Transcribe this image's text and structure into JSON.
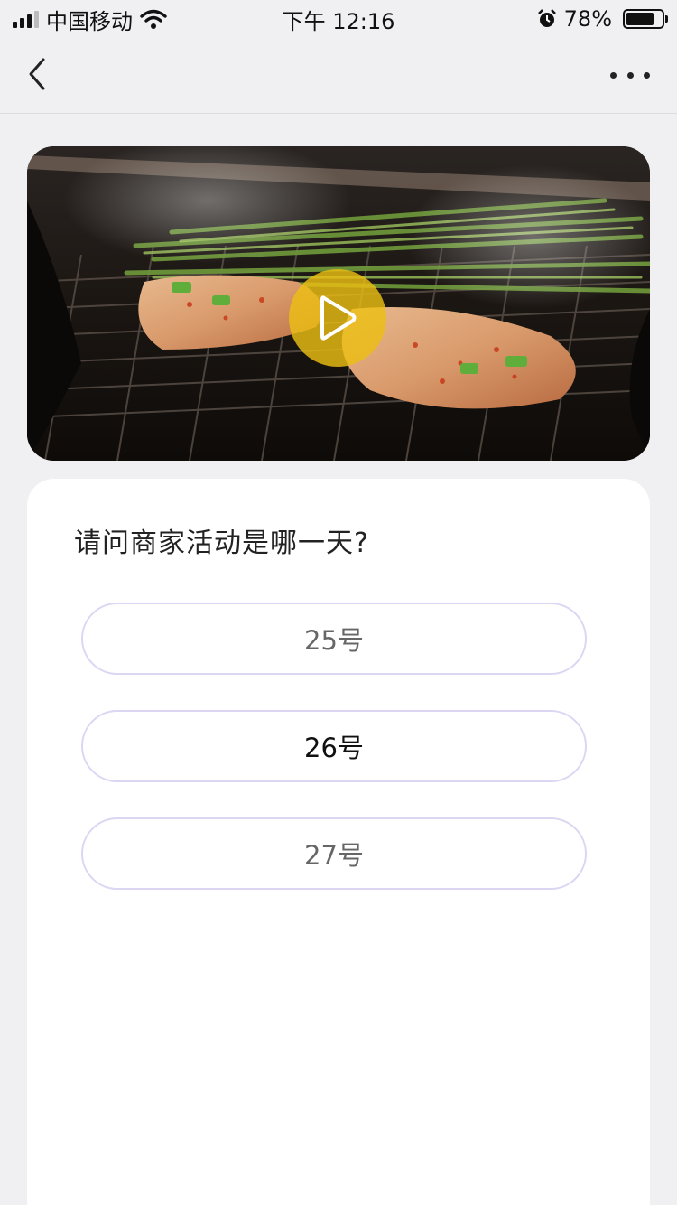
{
  "status_bar": {
    "carrier": "中国移动",
    "time": "下午 12:16",
    "battery_percent": "78%",
    "battery_level": 0.78,
    "icons": [
      "signal-icon",
      "wifi-icon",
      "alarm-icon",
      "battery-icon"
    ]
  },
  "nav": {
    "back_icon": "chevron-left-icon",
    "more_icon": "more-dots-icon"
  },
  "video": {
    "play_icon": "play-icon",
    "accent_color": "#ecbe14"
  },
  "quiz": {
    "question": "请问商家活动是哪一天?",
    "options": [
      {
        "label": "25号"
      },
      {
        "label": "26号"
      },
      {
        "label": "27号"
      }
    ],
    "border_color": "#dcd6f3"
  }
}
